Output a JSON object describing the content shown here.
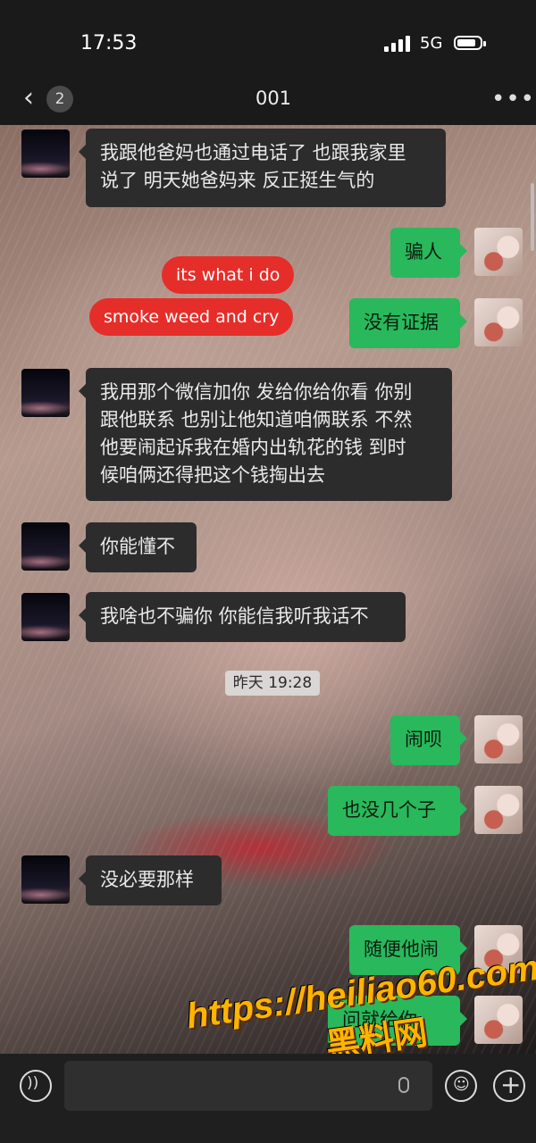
{
  "status_bar": {
    "time": "17:53",
    "network": "5G"
  },
  "header": {
    "unread_count": "2",
    "title": "001"
  },
  "timestamp": "昨天 19:28",
  "messages": [
    {
      "side": "in",
      "text": "我跟他爸妈也通过电话了 也跟我家里\n说了 明天她爸妈来 反正挺生气的"
    },
    {
      "side": "out",
      "text": "骗人"
    },
    {
      "side": "in",
      "text": "its what i do",
      "style": "red-sticker"
    },
    {
      "side": "in",
      "text": "smoke weed and cry",
      "style": "red-sticker"
    },
    {
      "side": "out",
      "text": "没有证据"
    },
    {
      "side": "in",
      "text": "我用那个微信加你 发给你给你看 你别\n跟他联系 也别让他知道咱俩联系 不然\n他要闹起诉我在婚内出轨花的钱 到时\n候咱俩还得把这个钱掏出去"
    },
    {
      "side": "in",
      "text": "你能懂不"
    },
    {
      "side": "in",
      "text": "我啥也不骗你 你能信我听我话不"
    },
    {
      "side": "out",
      "text": "闹呗"
    },
    {
      "side": "out",
      "text": "也没几个子"
    },
    {
      "side": "in",
      "text": "没必要那样"
    },
    {
      "side": "out",
      "text": "随便他闹"
    },
    {
      "side": "out",
      "text": "问就给你"
    }
  ],
  "watermark": {
    "url": "https://heiliao60.com",
    "cn": "黑料网"
  },
  "icons": {
    "back": "chevron-left-icon",
    "more": "more-dots-icon",
    "voice": "voice-icon",
    "emoji": "emoji-icon",
    "plus": "plus-icon",
    "mic": "mic-icon"
  },
  "colors": {
    "outgoing_bubble": "#29b85b",
    "incoming_bubble": "#2c2c2c",
    "sticker": "#e52e2a",
    "watermark": "#ffb400"
  }
}
